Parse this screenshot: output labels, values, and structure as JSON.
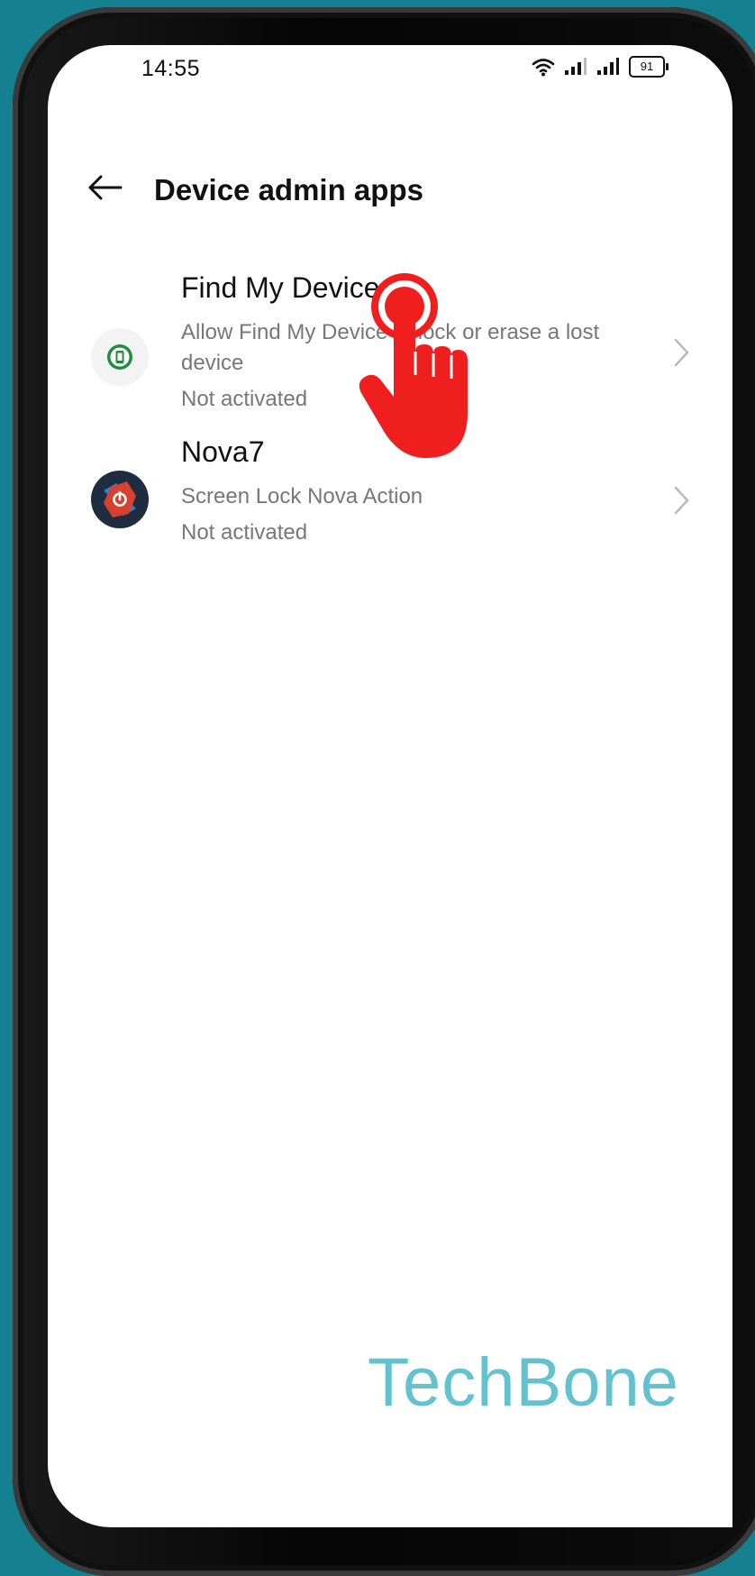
{
  "status_bar": {
    "time": "14:55",
    "battery": "91",
    "icons": [
      "wifi-icon",
      "signal-icon",
      "signal-icon",
      "battery-icon"
    ]
  },
  "header": {
    "title": "Device admin apps",
    "back_icon": "back-arrow-icon"
  },
  "apps": [
    {
      "name": "Find My Device",
      "description": "Allow Find My Device to lock or erase a lost device",
      "status": "Not activated",
      "icon": "find-my-device-icon",
      "icon_color": "#1e8e3e"
    },
    {
      "name": "Nova7",
      "description": "Screen Lock Nova Action",
      "status": "Not activated",
      "icon": "nova-icon",
      "icon_color": "#d8412f"
    }
  ],
  "overlay": {
    "tap_icon": "tap-hand-icon",
    "tap_color": "#f01f1f"
  },
  "watermark": "TechBone",
  "colors": {
    "background": "#15808f",
    "watermark": "#64c2cf"
  }
}
